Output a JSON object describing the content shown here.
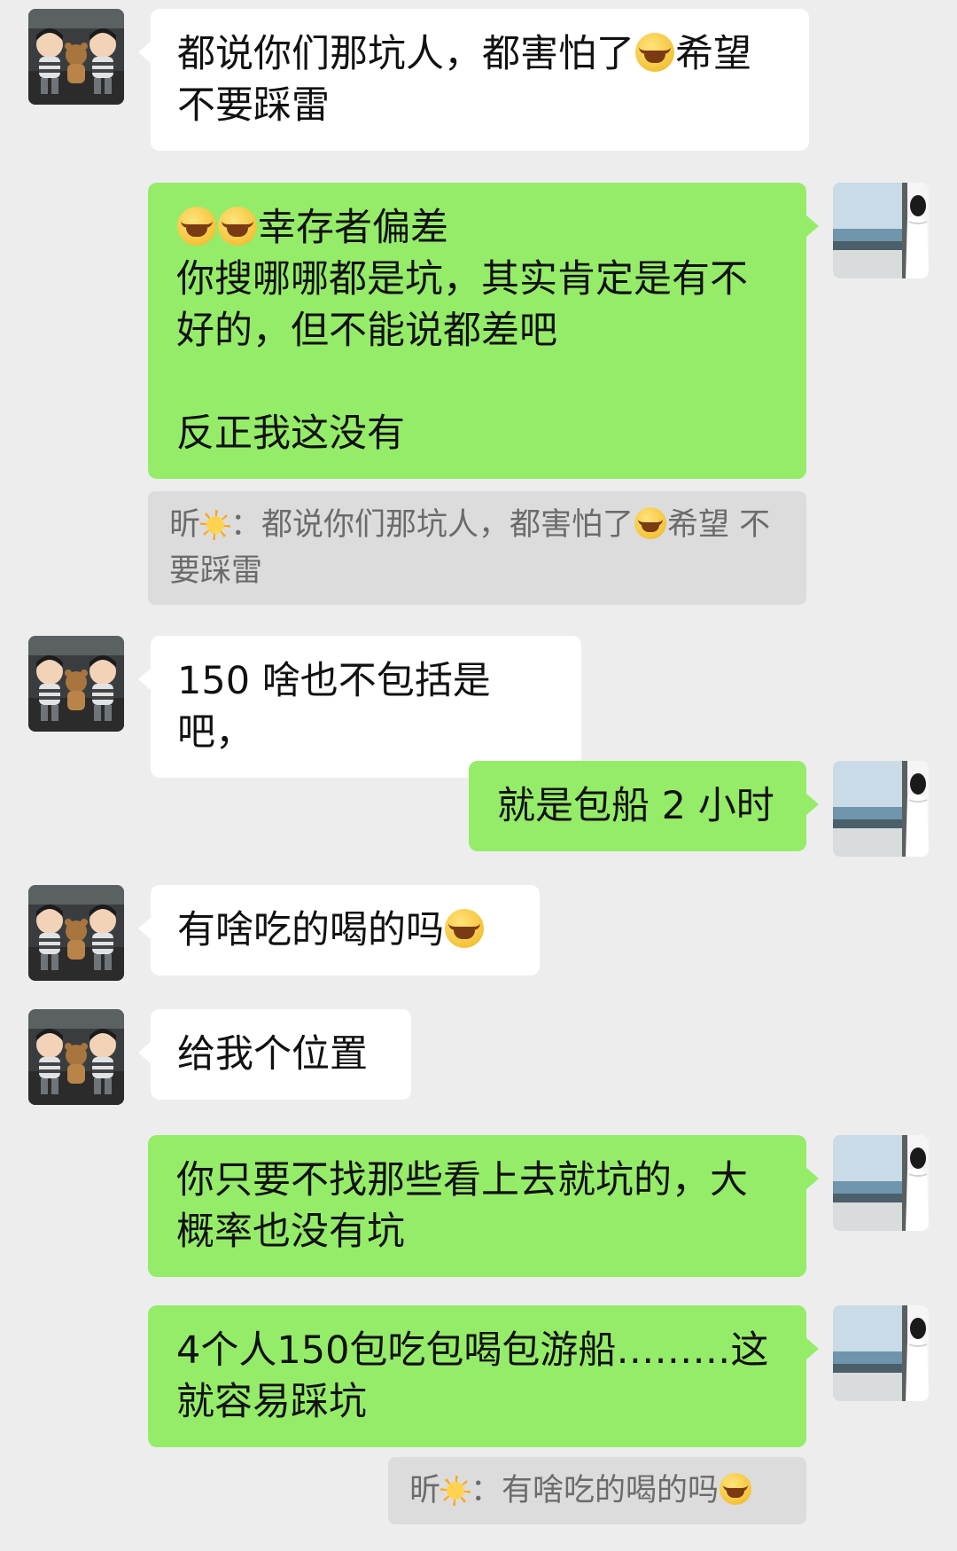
{
  "colors": {
    "background": "#ededed",
    "incoming_bubble": "#ffffff",
    "outgoing_bubble": "#95ec69",
    "quote_bg": "#dcdcdc"
  },
  "messages": [
    {
      "side": "left",
      "avatar": "toy-dolls-avatar",
      "text_a": "都说你们那坑人，都害怕了",
      "emoji": "loudly-crying-emoji",
      "text_b": "希望\n不要踩雷"
    },
    {
      "side": "right",
      "avatar": "seaside-window-avatar",
      "emojis": [
        "loudly-crying-emoji",
        "loudly-crying-emoji"
      ],
      "text_a": "幸存者偏差",
      "text_b": "你搜哪哪都是坑，其实肯定是有不\n好的，但不能说都差吧\n\n反正我这没有"
    },
    {
      "type": "quote",
      "sender": "昕",
      "sender_icon": "sun-emoji",
      "colon": "：",
      "text_a": "都说你们那坑人，都害怕了",
      "emoji": "loudly-crying-emoji",
      "text_b": "希望\n不要踩雷"
    },
    {
      "side": "left",
      "avatar": "toy-dolls-avatar",
      "text": "150 啥也不包括是吧，"
    },
    {
      "side": "right",
      "avatar": "seaside-window-avatar",
      "text": "就是包船 2 小时"
    },
    {
      "side": "left",
      "avatar": "toy-dolls-avatar",
      "text": "有啥吃的喝的吗",
      "emoji": "rolling-laughing-emoji"
    },
    {
      "side": "left",
      "avatar": "toy-dolls-avatar",
      "text": "给我个位置"
    },
    {
      "side": "right",
      "avatar": "seaside-window-avatar",
      "text": "你只要不找那些看上去就坑的，大\n概率也没有坑"
    },
    {
      "side": "right",
      "avatar": "seaside-window-avatar",
      "text": "4个人150包吃包喝包游船………这\n就容易踩坑"
    },
    {
      "type": "quote",
      "sender": "昕",
      "sender_icon": "sun-emoji",
      "colon": "：",
      "text": "有啥吃的喝的吗",
      "emoji": "rolling-laughing-emoji"
    }
  ]
}
